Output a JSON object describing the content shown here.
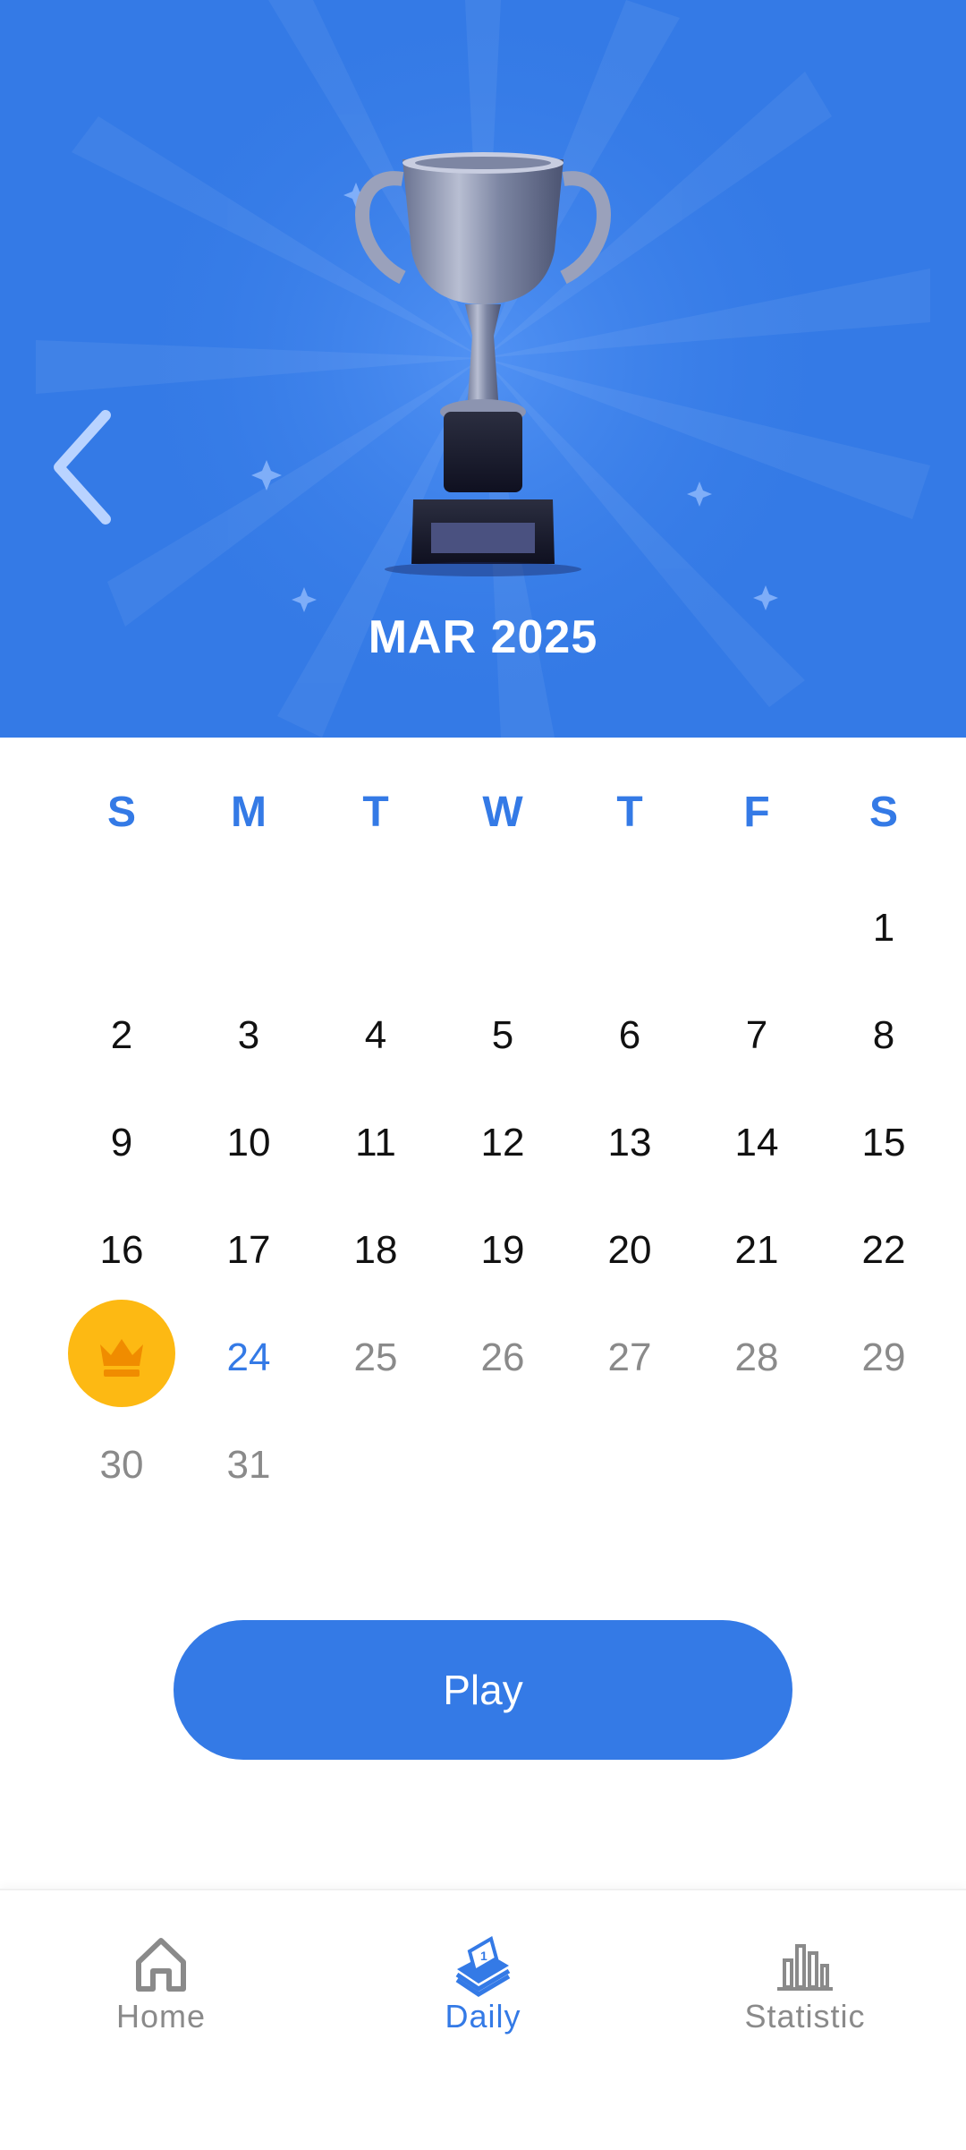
{
  "header": {
    "month_title": "MAR 2025",
    "back_icon": "chevron-left-icon",
    "trophy_icon": "silver-trophy-icon"
  },
  "calendar": {
    "weekdays": [
      "S",
      "M",
      "T",
      "W",
      "T",
      "F",
      "S"
    ],
    "days": {
      "d1": "1",
      "d2": "2",
      "d3": "3",
      "d4": "4",
      "d5": "5",
      "d6": "6",
      "d7": "7",
      "d8": "8",
      "d9": "9",
      "d10": "10",
      "d11": "11",
      "d12": "12",
      "d13": "13",
      "d14": "14",
      "d15": "15",
      "d16": "16",
      "d17": "17",
      "d18": "18",
      "d19": "19",
      "d20": "20",
      "d21": "21",
      "d22": "22",
      "d24": "24",
      "d25": "25",
      "d26": "26",
      "d27": "27",
      "d28": "28",
      "d29": "29",
      "d30": "30",
      "d31": "31"
    },
    "completed_day_icon": "crown-icon",
    "selected_day": "24"
  },
  "actions": {
    "play_label": "Play"
  },
  "bottom_nav": {
    "items": [
      {
        "label": "Home",
        "icon": "home-icon"
      },
      {
        "label": "Daily",
        "icon": "calendar-book-icon"
      },
      {
        "label": "Statistic",
        "icon": "bar-chart-icon"
      }
    ],
    "active": "Daily"
  },
  "colors": {
    "accent": "#347ae6",
    "crown_badge": "#fdb913",
    "muted_text": "#8a8a8a"
  }
}
